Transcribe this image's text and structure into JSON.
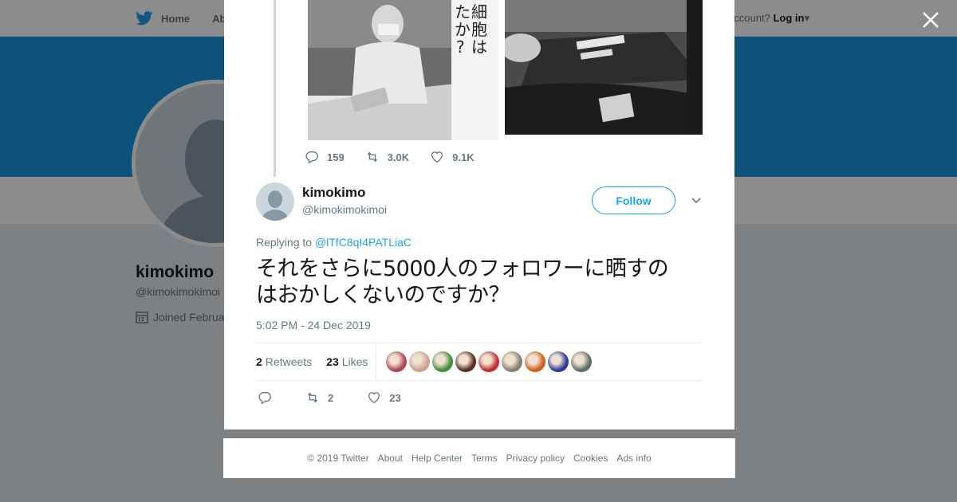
{
  "background": {
    "nav_home": "Home",
    "nav_about": "Abo",
    "account_prompt": "ccount?",
    "login": "Log in",
    "profile_name": "kimokimo",
    "profile_handle": "@kimokimokimoi",
    "joined": "Joined Februa"
  },
  "photo_text": "細胞は\nたか?",
  "parent_tweet": {
    "replies": "159",
    "retweets": "3.0K",
    "likes": "9.1K"
  },
  "tweet": {
    "author_name": "kimokimo",
    "author_handle": "@kimokimokimoi",
    "follow_label": "Follow",
    "replying_prefix": "Replying to ",
    "replying_to": "@lTfC8qI4PATLiaC",
    "text_line1": "それをさらに5000人のフォロワーに晒すの",
    "text_line2": "はおかしくないのですか？",
    "timestamp": "5:02 PM - 24 Dec 2019",
    "retweets_count": "2",
    "retweets_label": "Retweets",
    "likes_count": "23",
    "likes_label": "Likes",
    "action_retweets": "2",
    "action_likes": "23"
  },
  "likers": [
    {
      "color": "#b0445a"
    },
    {
      "color": "#c9a48a"
    },
    {
      "color": "#3f8f3a"
    },
    {
      "color": "#5a3020"
    },
    {
      "color": "#c43030"
    },
    {
      "color": "#8a8070"
    },
    {
      "color": "#d06018"
    },
    {
      "color": "#2a3a9a"
    },
    {
      "color": "#607068"
    }
  ],
  "footer": {
    "copyright": "© 2019 Twitter",
    "about": "About",
    "help": "Help Center",
    "terms": "Terms",
    "privacy": "Privacy policy",
    "cookies": "Cookies",
    "ads": "Ads info"
  },
  "colors": {
    "accent": "#1da1f2",
    "banner": "#1b95e0"
  }
}
